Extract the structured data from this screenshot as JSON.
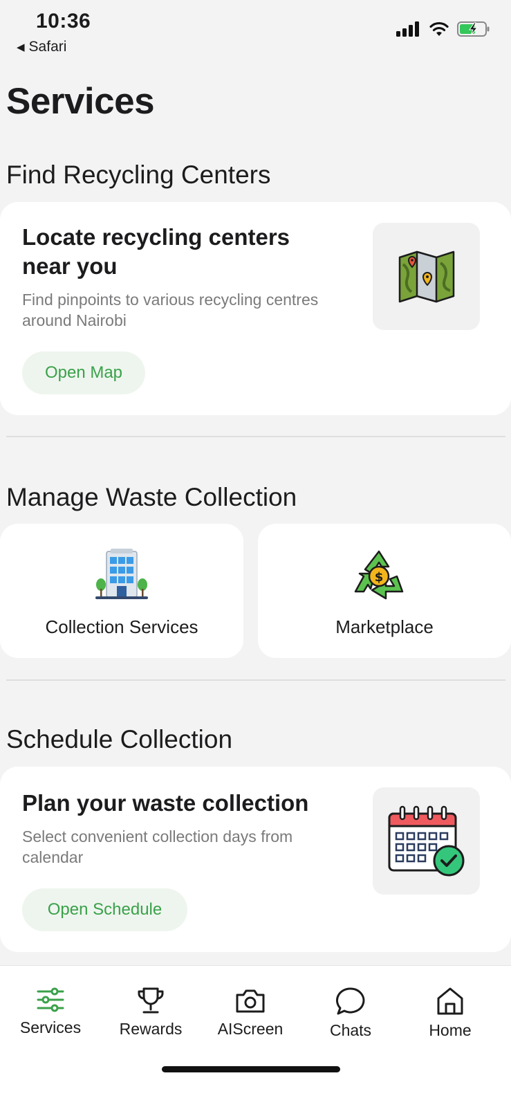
{
  "status_bar": {
    "time": "10:36",
    "back_app": "Safari"
  },
  "page_title": "Services",
  "recycling": {
    "section_title": "Find Recycling Centers",
    "headline": "Locate recycling centers near you",
    "description": "Find pinpoints to various recycling centres around Nairobi",
    "button": "Open Map",
    "icon": "map-icon"
  },
  "waste": {
    "section_title": "Manage Waste Collection",
    "cards": [
      {
        "label": "Collection Services",
        "icon": "building-icon"
      },
      {
        "label": "Marketplace",
        "icon": "recycle-money-icon"
      }
    ]
  },
  "schedule": {
    "section_title": "Schedule Collection",
    "headline": "Plan your waste collection",
    "description": "Select convenient collection days from calendar",
    "button": "Open Schedule",
    "icon": "calendar-check-icon"
  },
  "tabs": [
    {
      "label": "Services",
      "icon": "sliders-icon",
      "active": true
    },
    {
      "label": "Rewards",
      "icon": "trophy-icon",
      "active": false
    },
    {
      "label": "AIScreen",
      "icon": "camera-icon",
      "active": false
    },
    {
      "label": "Chats",
      "icon": "chat-bubble-icon",
      "active": false
    },
    {
      "label": "Home",
      "icon": "home-icon",
      "active": false
    }
  ],
  "colors": {
    "accent": "#3aa14a",
    "background": "#f3f3f3",
    "card": "#ffffff"
  }
}
